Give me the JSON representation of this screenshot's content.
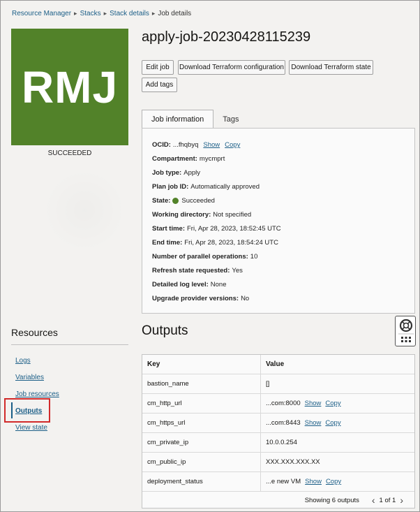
{
  "breadcrumb": {
    "items": [
      "Resource Manager",
      "Stacks",
      "Stack details"
    ],
    "current": "Job details"
  },
  "logo": {
    "text": "RMJ",
    "color": "#528229"
  },
  "status_under_logo": "SUCCEEDED",
  "title": "apply-job-20230428115239",
  "actions": {
    "edit_job": "Edit job",
    "download_config": "Download Terraform configuration",
    "download_state": "Download Terraform state",
    "add_tags": "Add tags"
  },
  "tabs": {
    "job_information": "Job information",
    "tags": "Tags"
  },
  "job_info": {
    "ocid_label": "OCID:",
    "ocid_value": "...fhqbyq",
    "show": "Show",
    "copy": "Copy",
    "compartment_label": "Compartment:",
    "compartment_value": "mycmprt",
    "job_type_label": "Job type:",
    "job_type_value": "Apply",
    "plan_job_label": "Plan job ID:",
    "plan_job_value": "Automatically approved",
    "state_label": "State:",
    "state_value": "Succeeded",
    "working_dir_label": "Working directory:",
    "working_dir_value": "Not specified",
    "start_label": "Start time:",
    "start_value": "Fri, Apr 28, 2023, 18:52:45 UTC",
    "end_label": "End time:",
    "end_value": "Fri, Apr 28, 2023, 18:54:24 UTC",
    "parallel_label": "Number of parallel operations:",
    "parallel_value": "10",
    "refresh_label": "Refresh state requested:",
    "refresh_value": "Yes",
    "log_level_label": "Detailed log level:",
    "log_level_value": "None",
    "upgrade_label": "Upgrade provider versions:",
    "upgrade_value": "No"
  },
  "resources": {
    "heading": "Resources",
    "items": [
      "Logs",
      "Variables",
      "Job resources",
      "Outputs",
      "View state"
    ],
    "active": "Outputs"
  },
  "outputs": {
    "title": "Outputs",
    "columns": [
      "Key",
      "Value"
    ],
    "rows": [
      {
        "key": "bastion_name",
        "value": "[]"
      },
      {
        "key": "cm_http_url",
        "value": "...com:8000",
        "show": "Show",
        "copy": "Copy"
      },
      {
        "key": "cm_https_url",
        "value": "...com:8443",
        "show": "Show",
        "copy": "Copy"
      },
      {
        "key": "cm_private_ip",
        "value": "10.0.0.254"
      },
      {
        "key": "cm_public_ip",
        "value": "XXX.XXX.XXX.XX"
      },
      {
        "key": "deployment_status",
        "value": "...e new VM",
        "show": "Show",
        "copy": "Copy"
      }
    ],
    "showing": "Showing 6 outputs",
    "page": "1 of 1"
  },
  "icons": {
    "help": "lifebuoy-icon",
    "apps": "grid-icon",
    "prev": "chevron-left-icon",
    "next": "chevron-right-icon",
    "state_dot": "status-dot-icon"
  }
}
